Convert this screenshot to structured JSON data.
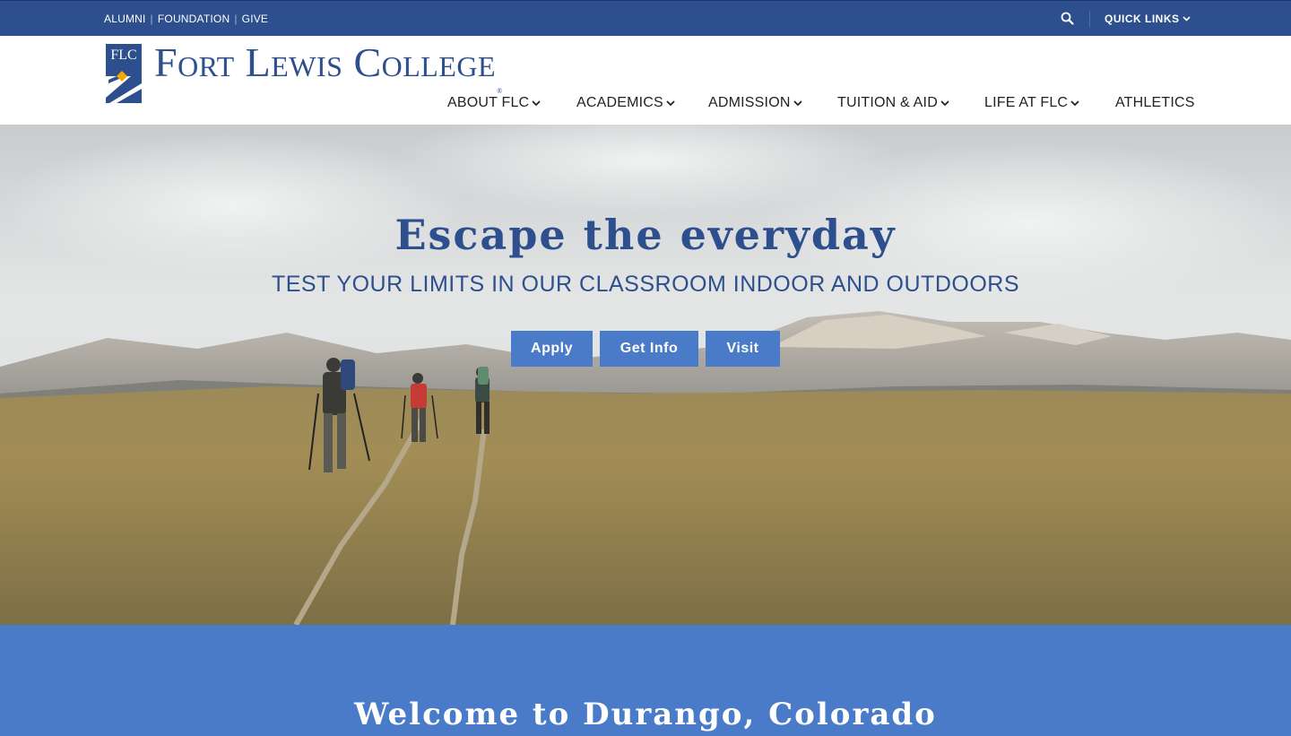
{
  "utility_bar": {
    "links": [
      "ALUMNI",
      "FOUNDATION",
      "GIVE"
    ],
    "quick_links_label": "QUICK LINKS"
  },
  "header": {
    "logo_mark_text": "FLC",
    "logo_text": "Fort Lewis College",
    "logo_reg": "®"
  },
  "nav": {
    "items": [
      {
        "label": "ABOUT FLC",
        "has_dropdown": true
      },
      {
        "label": "ACADEMICS",
        "has_dropdown": true
      },
      {
        "label": "ADMISSION",
        "has_dropdown": true
      },
      {
        "label": "TUITION & AID",
        "has_dropdown": true
      },
      {
        "label": "LIFE AT FLC",
        "has_dropdown": true
      },
      {
        "label": "ATHLETICS",
        "has_dropdown": false
      }
    ]
  },
  "hero": {
    "title": "Escape the everyday",
    "subtitle": "TEST YOUR LIMITS IN OUR CLASSROOM INDOOR AND OUTDOORS",
    "buttons": {
      "apply": "Apply",
      "get_info": "Get Info",
      "visit": "Visit"
    }
  },
  "welcome": {
    "title": "Welcome to Durango, Colorado"
  },
  "colors": {
    "brand_blue": "#2d4f8e",
    "accent_blue": "#4a7bc8",
    "logo_gold": "#f2a900"
  },
  "icons": {
    "search": "search-icon",
    "chevron": "chevron-down-icon"
  }
}
